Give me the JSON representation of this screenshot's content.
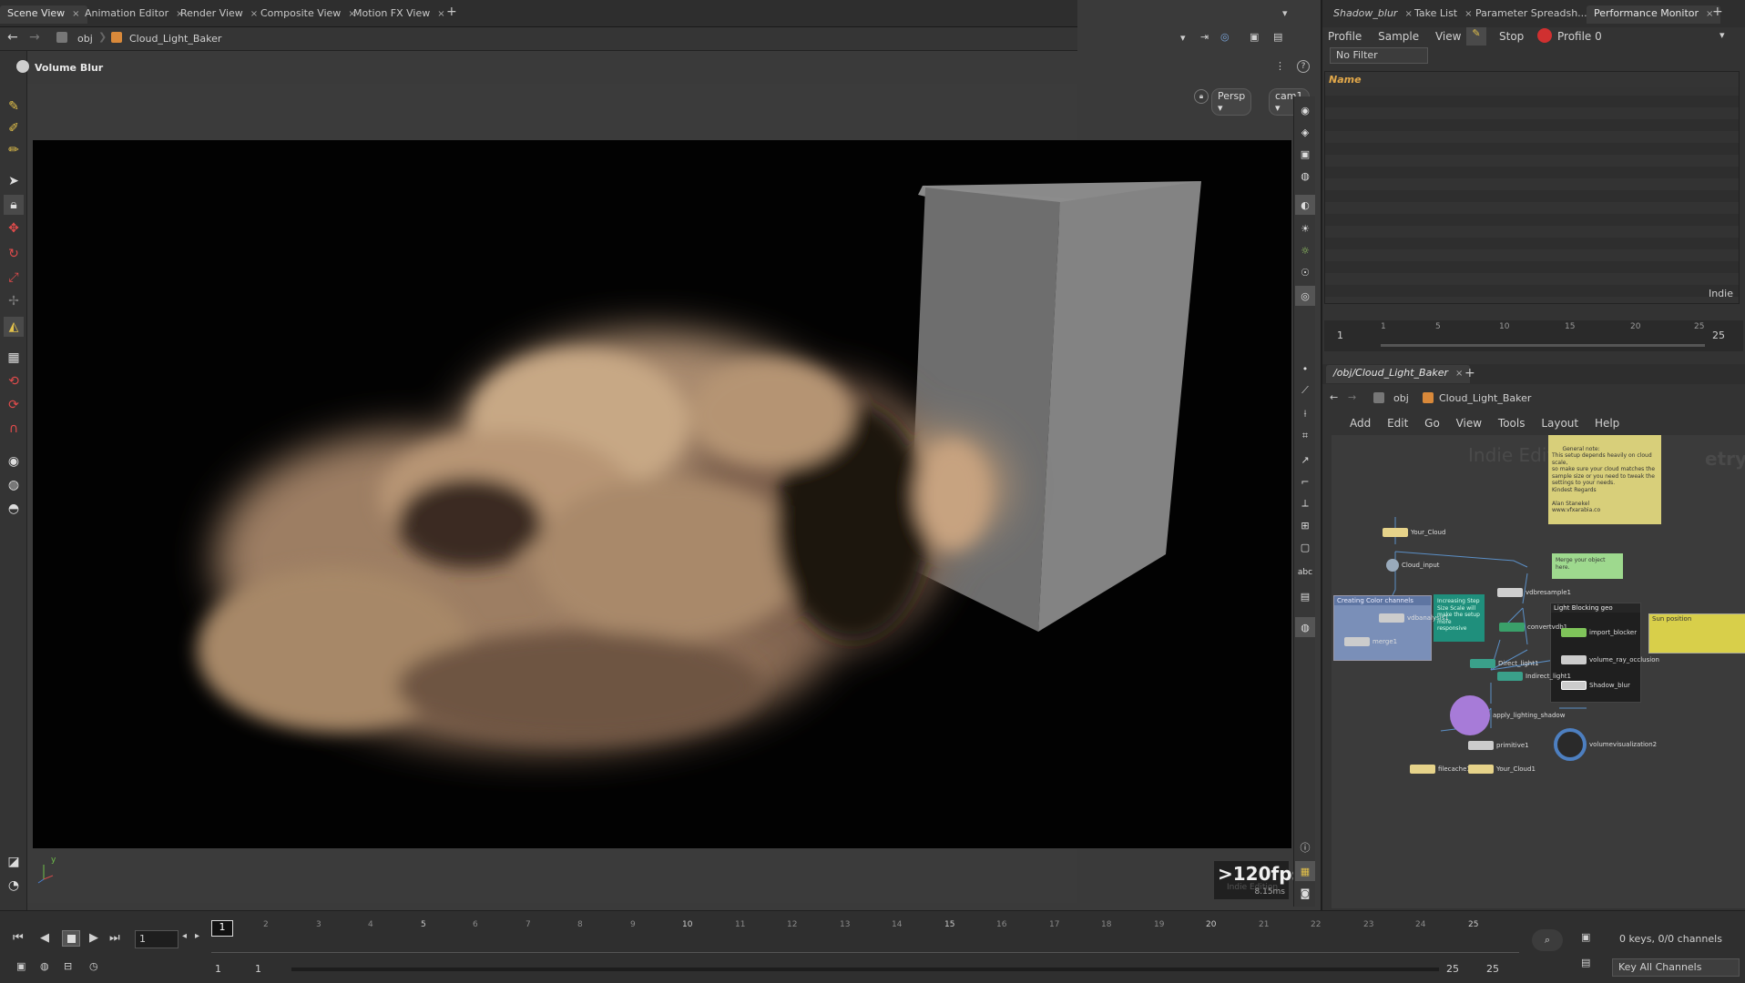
{
  "left_tabs": [
    {
      "label": "Scene View",
      "active": true
    },
    {
      "label": "Animation Editor"
    },
    {
      "label": "Render View"
    },
    {
      "label": "Composite View"
    },
    {
      "label": "Motion FX View"
    }
  ],
  "left_path": {
    "root": "obj",
    "node": "Cloud_Light_Baker"
  },
  "viewport": {
    "title": "Volume Blur",
    "projection": "Persp",
    "camera": "cam1",
    "fps": ">120fps",
    "watermark": "Indie Edition",
    "time": "8.15ms",
    "axis_y": "y"
  },
  "right_tabs": [
    {
      "label": "Shadow_blur"
    },
    {
      "label": "Take List"
    },
    {
      "label": "Parameter Spreadsh..."
    },
    {
      "label": "Performance Monitor",
      "active": true
    }
  ],
  "perf": {
    "menu": [
      "Profile",
      "Sample",
      "View"
    ],
    "stop": "Stop",
    "profile_name": "Profile 0",
    "filter": "No Filter",
    "col_name": "Name",
    "indie": "Indie"
  },
  "mini_timeline": {
    "start": "1",
    "end": "25",
    "ticks": [
      "1",
      "5",
      "10",
      "15",
      "20",
      "25"
    ]
  },
  "network": {
    "tab": "/obj/Cloud_Light_Baker",
    "path_root": "obj",
    "path_node": "Cloud_Light_Baker",
    "menu": [
      "Add",
      "Edit",
      "Go",
      "View",
      "Tools",
      "Layout",
      "Help"
    ],
    "watermark": "Indie Edition",
    "watermark2": "etry",
    "sticky_note": "General note:\nThis setup depends heavily on cloud scale,\nso make sure your cloud matches the\nsample size or you need to tweak the\nsettings to your needs.\nKindest Regards\n\nAlan Stanekel\nwww.vfxarabia.co",
    "merge_note": "Merge your object here.",
    "step_note": "Increasing Step Size Scale will make the setup more responsive",
    "box_color": "Creating Color channels",
    "box_light": "Light Blocking geo",
    "box_sun": "Sun position",
    "nodes": {
      "your_cloud": "Your_Cloud",
      "cloud_input": "Cloud_input",
      "vdbresample": "vdbresample1",
      "vdbanalysis": "vdbanalysis1",
      "convertvdb": "convertvdb1",
      "merge": "merge1",
      "direct": "Direct_light1",
      "indirect": "Indirect_light1",
      "import_blocker": "import_blocker",
      "ray_occlusion": "volume_ray_occlusion",
      "shadow_blur": "Shadow_blur",
      "apply_shadow": "apply_lighting_shadow",
      "primitive": "primitive1",
      "volvis": "volumevisualization2",
      "filecache": "filecache1",
      "your_cloud1": "Your_Cloud1"
    }
  },
  "timeline": {
    "frame": "1",
    "ticks": [
      "1",
      "2",
      "3",
      "4",
      "5",
      "6",
      "7",
      "8",
      "9",
      "10",
      "11",
      "12",
      "13",
      "14",
      "15",
      "16",
      "17",
      "18",
      "19",
      "20",
      "21",
      "22",
      "23",
      "24",
      "25"
    ],
    "range_start": "1",
    "range_start2": "1",
    "range_end": "25",
    "range_end2": "25",
    "keys": "0 keys, 0/0 channels",
    "key_all": "Key All Channels"
  }
}
